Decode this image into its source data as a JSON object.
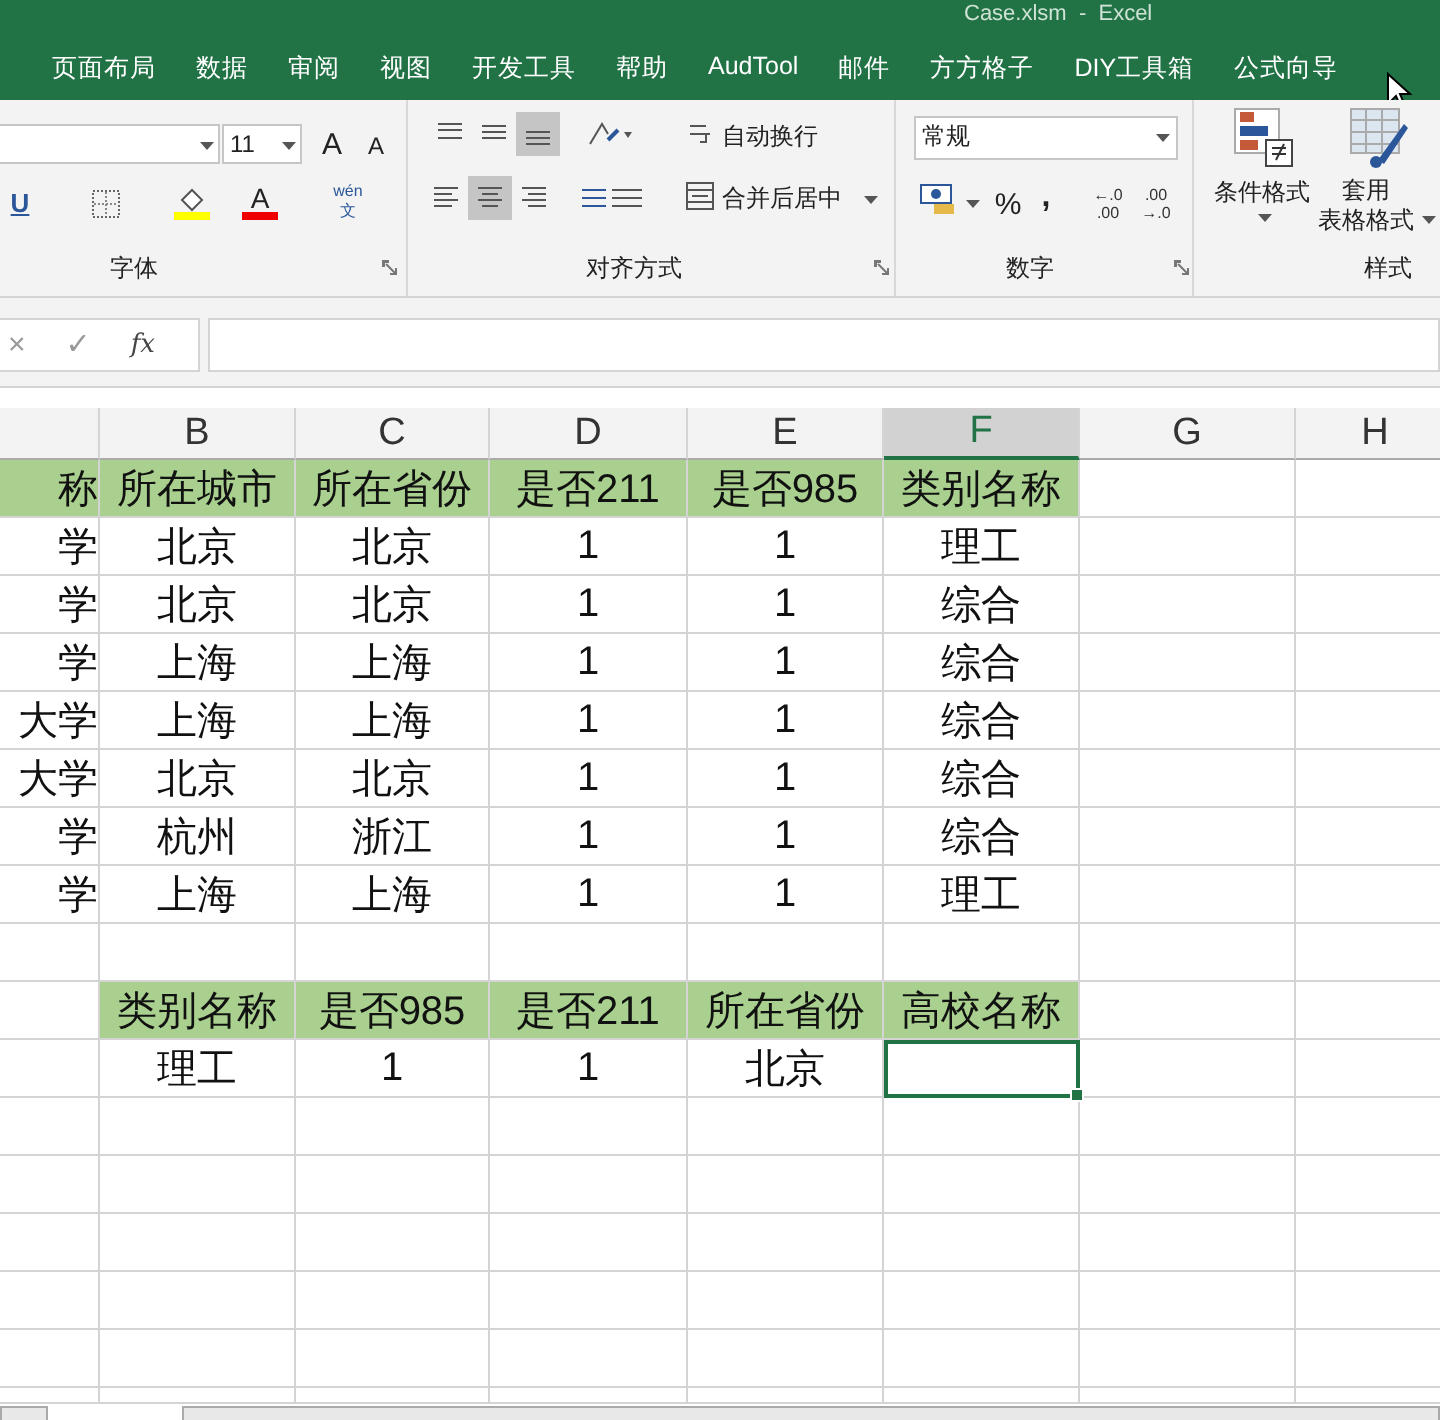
{
  "window": {
    "title": "Case.xlsm  -  Excel"
  },
  "menu_tabs": [
    {
      "label": "页面布局",
      "selected": false
    },
    {
      "label": "数据",
      "selected": false
    },
    {
      "label": "审阅",
      "selected": false
    },
    {
      "label": "视图",
      "selected": false
    },
    {
      "label": "开发工具",
      "selected": false
    },
    {
      "label": "帮助",
      "selected": false
    },
    {
      "label": "AudTool",
      "selected": false
    },
    {
      "label": "邮件",
      "selected": false
    },
    {
      "label": "方方格子",
      "selected": false
    },
    {
      "label": "DIY工具箱",
      "selected": false
    },
    {
      "label": "公式向导",
      "selected": false
    }
  ],
  "ribbon": {
    "font": {
      "label": "字体",
      "font_size": "11",
      "grow": "A",
      "shrink": "A",
      "underline": "U",
      "font_color": "A",
      "phonetic_top": "wén",
      "phonetic_bottom": "文"
    },
    "alignment": {
      "label": "对齐方式",
      "wrap_text": "自动换行",
      "merge_center": "合并后居中",
      "vertical": [
        {
          "selected": false
        },
        {
          "selected": false
        },
        {
          "selected": true
        }
      ],
      "horizontal": [
        {
          "selected": false
        },
        {
          "selected": true
        },
        {
          "selected": false
        }
      ]
    },
    "number": {
      "label": "数字",
      "format": "常规",
      "percent": "%",
      "comma": ",",
      "increase_decimal": [
        "←.0",
        ".00"
      ],
      "decrease_decimal": [
        ".00",
        "→.0"
      ]
    },
    "styles": {
      "label": "样式",
      "conditional": "条件格式",
      "table_format": [
        "套用",
        "表格格式"
      ]
    }
  },
  "formula_bar": {
    "cancel": "×",
    "enter": "✓",
    "fx": "fx"
  },
  "sheet": {
    "columns": [
      {
        "label": "B",
        "selected": false
      },
      {
        "label": "C",
        "selected": false
      },
      {
        "label": "D",
        "selected": false
      },
      {
        "label": "E",
        "selected": false
      },
      {
        "label": "F",
        "selected": true
      },
      {
        "label": "G",
        "selected": false
      },
      {
        "label": "H",
        "selected": false
      }
    ],
    "rows": [
      {
        "kind": "header",
        "cells": [
          {
            "text": "称",
            "selected": false
          },
          {
            "text": "所在城市",
            "selected": false
          },
          {
            "text": "所在省份",
            "selected": false
          },
          {
            "text": "是否211",
            "selected": false
          },
          {
            "text": "是否985",
            "selected": false
          },
          {
            "text": "类别名称",
            "selected": false
          }
        ]
      },
      {
        "kind": "data",
        "cells": [
          {
            "text": "学",
            "selected": false
          },
          {
            "text": "北京",
            "selected": false
          },
          {
            "text": "北京",
            "selected": false
          },
          {
            "text": "1",
            "selected": false
          },
          {
            "text": "1",
            "selected": false
          },
          {
            "text": "理工",
            "selected": false
          }
        ]
      },
      {
        "kind": "data",
        "cells": [
          {
            "text": "学",
            "selected": false
          },
          {
            "text": "北京",
            "selected": false
          },
          {
            "text": "北京",
            "selected": false
          },
          {
            "text": "1",
            "selected": false
          },
          {
            "text": "1",
            "selected": false
          },
          {
            "text": "综合",
            "selected": false
          }
        ]
      },
      {
        "kind": "data",
        "cells": [
          {
            "text": "学",
            "selected": false
          },
          {
            "text": "上海",
            "selected": false
          },
          {
            "text": "上海",
            "selected": false
          },
          {
            "text": "1",
            "selected": false
          },
          {
            "text": "1",
            "selected": false
          },
          {
            "text": "综合",
            "selected": false
          }
        ]
      },
      {
        "kind": "data",
        "cells": [
          {
            "text": "大学",
            "selected": false
          },
          {
            "text": "上海",
            "selected": false
          },
          {
            "text": "上海",
            "selected": false
          },
          {
            "text": "1",
            "selected": false
          },
          {
            "text": "1",
            "selected": false
          },
          {
            "text": "综合",
            "selected": false
          }
        ]
      },
      {
        "kind": "data",
        "cells": [
          {
            "text": "大学",
            "selected": false
          },
          {
            "text": "北京",
            "selected": false
          },
          {
            "text": "北京",
            "selected": false
          },
          {
            "text": "1",
            "selected": false
          },
          {
            "text": "1",
            "selected": false
          },
          {
            "text": "综合",
            "selected": false
          }
        ]
      },
      {
        "kind": "data",
        "cells": [
          {
            "text": "学",
            "selected": false
          },
          {
            "text": "杭州",
            "selected": false
          },
          {
            "text": "浙江",
            "selected": false
          },
          {
            "text": "1",
            "selected": false
          },
          {
            "text": "1",
            "selected": false
          },
          {
            "text": "综合",
            "selected": false
          }
        ]
      },
      {
        "kind": "data",
        "cells": [
          {
            "text": "学",
            "selected": false
          },
          {
            "text": "上海",
            "selected": false
          },
          {
            "text": "上海",
            "selected": false
          },
          {
            "text": "1",
            "selected": false
          },
          {
            "text": "1",
            "selected": false
          },
          {
            "text": "理工",
            "selected": false
          }
        ]
      },
      {
        "kind": "blank"
      },
      {
        "kind": "header",
        "cells": [
          {
            "text": null,
            "selected": false
          },
          {
            "text": "类别名称",
            "selected": false
          },
          {
            "text": "是否985",
            "selected": false
          },
          {
            "text": "是否211",
            "selected": false
          },
          {
            "text": "所在省份",
            "selected": false
          },
          {
            "text": "高校名称",
            "selected": false
          }
        ]
      },
      {
        "kind": "data",
        "cells": [
          {
            "text": null,
            "selected": false
          },
          {
            "text": "理工",
            "selected": false
          },
          {
            "text": "1",
            "selected": false
          },
          {
            "text": "1",
            "selected": false
          },
          {
            "text": "北京",
            "selected": false
          },
          {
            "text": null,
            "selected": true
          }
        ]
      },
      {
        "kind": "blank"
      },
      {
        "kind": "blank"
      },
      {
        "kind": "blank"
      },
      {
        "kind": "blank"
      },
      {
        "kind": "blank"
      },
      {
        "kind": "blank"
      }
    ]
  }
}
